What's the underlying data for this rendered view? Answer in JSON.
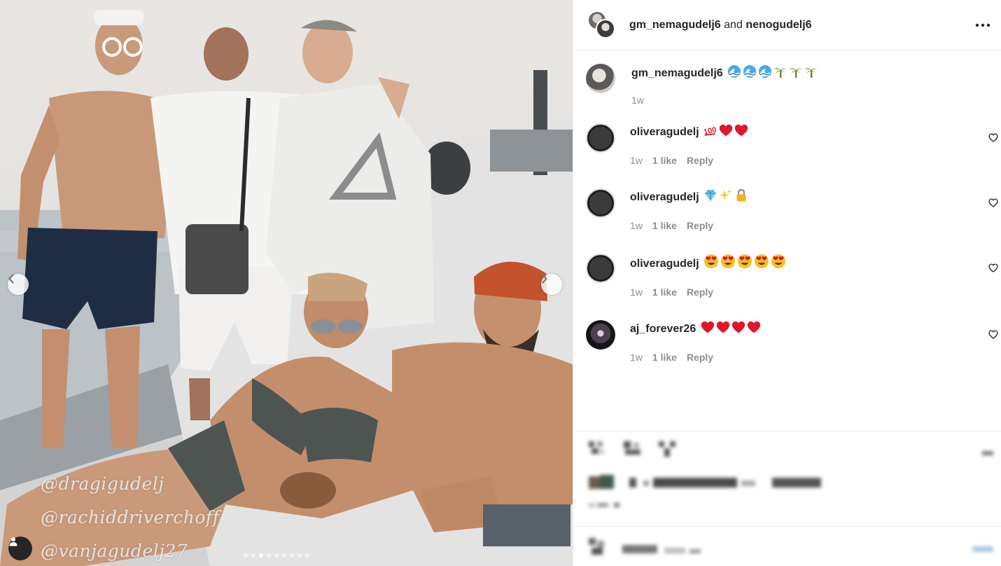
{
  "post": {
    "header": {
      "user1": "gm_nemagudelj6",
      "conjunction": "and",
      "user2": "nenogudelj6"
    },
    "caption": {
      "username": "gm_nemagudelj6",
      "emoji": [
        "wave",
        "wave",
        "wave",
        "palm",
        "palm",
        "palm"
      ],
      "time": "1w"
    },
    "comments": [
      {
        "username": "oliveragudelj",
        "emoji": [
          "hundred",
          "heart",
          "heart"
        ],
        "time": "1w",
        "likes": "1 like",
        "reply": "Reply"
      },
      {
        "username": "oliveragudelj",
        "emoji": [
          "gem",
          "sparkles",
          "lock"
        ],
        "time": "1w",
        "likes": "1 like",
        "reply": "Reply"
      },
      {
        "username": "oliveragudelj",
        "emoji": [
          "heart-eyes",
          "heart-eyes",
          "heart-eyes",
          "heart-eyes",
          "heart-eyes"
        ],
        "time": "1w",
        "likes": "1 like",
        "reply": "Reply"
      },
      {
        "username": "aj_forever26",
        "emoji": [
          "heart",
          "heart",
          "heart",
          "heart"
        ],
        "time": "1w",
        "likes": "1 like",
        "reply": "Reply"
      }
    ],
    "photo": {
      "watermarks": [
        "@dragigudelj",
        "@rachiddriverchoff",
        "@vanjagudelj27"
      ],
      "carousel_pages": 9,
      "active_page": 3
    }
  },
  "icons": {
    "more": "more-horizontal-icon",
    "like": "heart-outline-icon",
    "prev": "chevron-left-icon",
    "next": "chevron-right-icon",
    "tags": "user-tag-icon"
  },
  "colors": {
    "text": "#262626",
    "secondary": "#8e8e8e",
    "border": "#efefef",
    "heart_red": "#e0162b"
  }
}
